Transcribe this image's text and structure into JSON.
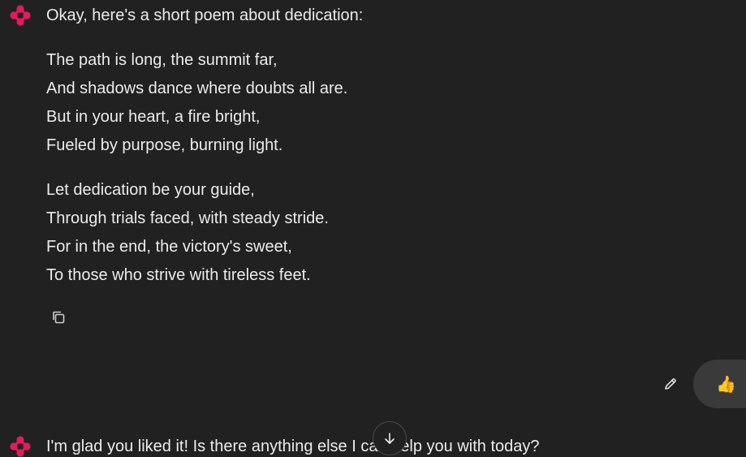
{
  "colors": {
    "background": "#212121",
    "text": "#ececec",
    "avatar_accent": "#e8195e",
    "bubble": "#3a3a3a"
  },
  "messages": {
    "assistant_intro": "Okay, here's a short poem about dedication:",
    "poem": {
      "stanza1": [
        "The path is long, the summit far,",
        "And shadows dance where doubts all are.",
        "But in your heart, a fire bright,",
        "Fueled by purpose, burning light."
      ],
      "stanza2": [
        "Let dedication be your guide,",
        "Through trials faced, with steady stride.",
        "For in the end, the victory's sweet,",
        "To those who strive with tireless feet."
      ]
    },
    "user_reply_emoji": "👍",
    "assistant_reply": "I'm glad you liked it! Is there anything else I can help you with today?"
  },
  "icons": {
    "assistant_avatar": "gemini-flower-icon",
    "copy": "copy-icon",
    "edit": "pencil-icon",
    "scroll": "arrow-down-icon"
  }
}
